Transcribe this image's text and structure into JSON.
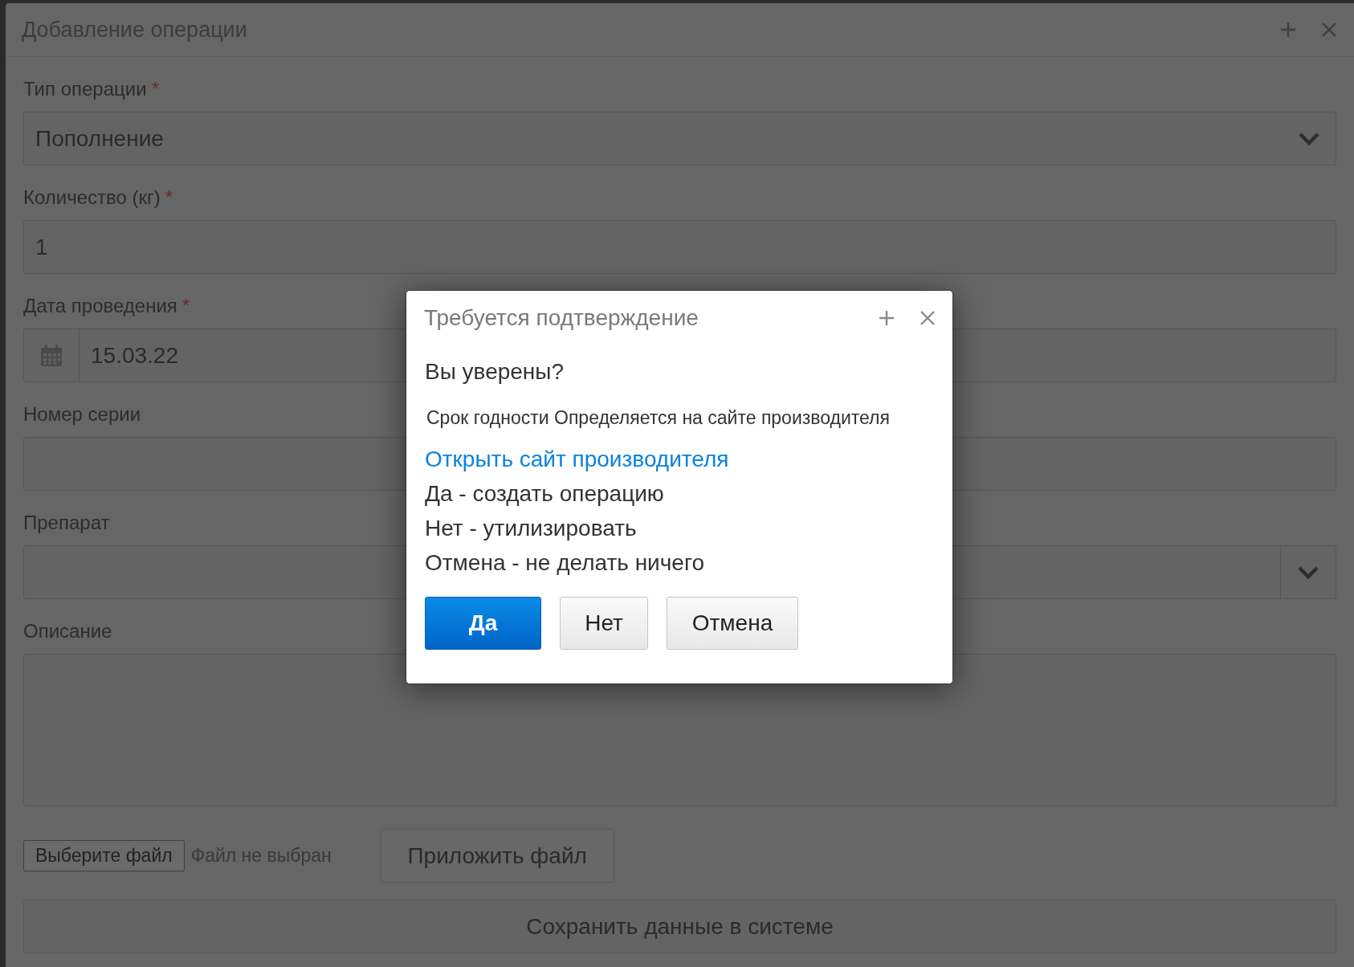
{
  "window": {
    "title": "Добавление операции"
  },
  "form": {
    "fields": [
      {
        "kind": "select",
        "label": "Тип операции",
        "required_mark": "*",
        "value": "Пополнение"
      },
      {
        "kind": "text",
        "label": "Количество (кг)",
        "required_mark": "*",
        "value": "1"
      },
      {
        "kind": "date",
        "label": "Дата проведения",
        "required_mark": "*",
        "value": "15.03.22"
      },
      {
        "kind": "text",
        "label": "Номер серии"
      },
      {
        "kind": "select-addon",
        "label": "Препарат"
      },
      {
        "kind": "textarea",
        "label": "Описание"
      }
    ],
    "file_input": {
      "button": "Выберите файл",
      "status": "Файл не выбран"
    },
    "attach_button": "Приложить файл",
    "save_button": "Сохранить данные в системе"
  },
  "dialog": {
    "title": "Требуется подтверждение",
    "question": "Вы уверены?",
    "message": "Срок годности Определяется на сайте производителя",
    "link": "Открыть сайт производителя",
    "lines": [
      "Да - создать операцию",
      "Нет - утилизировать",
      "Отмена - не делать ничего"
    ],
    "buttons": [
      {
        "label": "Да",
        "primary": true
      },
      {
        "label": "Нет",
        "primary": false
      },
      {
        "label": "Отмена",
        "primary": false
      }
    ]
  }
}
